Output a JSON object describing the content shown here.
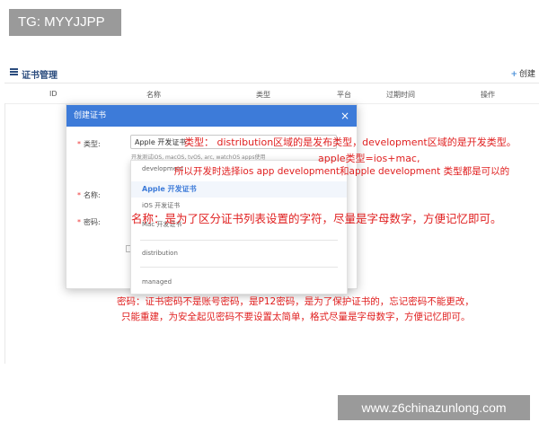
{
  "watermark": {
    "tag": "TG: MYYJJPP",
    "site": "www.z6chinazunlong.com"
  },
  "header": {
    "title": "证书管理",
    "create_label": "创建",
    "create_icon": "plus-icon"
  },
  "table": {
    "columns": [
      "ID",
      "名称",
      "类型",
      "平台",
      "过期时间",
      "操作"
    ]
  },
  "modal": {
    "title": "创建证书",
    "close_glyph": "×",
    "fields": {
      "type_label": "类型:",
      "type_value": "Apple 开发证书",
      "type_hint": "开发测试iOS, macOS, tvOS, arc, watchOS apps使用",
      "name_label": "名称:",
      "password_label": "密码:"
    },
    "dropdown": {
      "options": [
        "development",
        "Apple 开发证书",
        "iOS 开发证书",
        "Mac 开发证书",
        "distribution",
        "managed"
      ],
      "selected": "Apple 开发证书"
    }
  },
  "annotations": {
    "type_note": "类型：  distribution区域的是发布类型，development区域的是开发类型。",
    "apple_note": "apple类型=ios+mac,",
    "dev_note": "所以开发时选择ios app development和apple development 类型都是可以的",
    "name_note": "名称：是为了区分证书列表设置的字符，尽量是字母数字，方便记忆即可。",
    "password_note_1": "密码：证书密码不是账号密码，是P12密码，是为了保护证书的，忘记密码不能更改，",
    "password_note_2": "只能重建，为安全起见密码不要设置太简单，格式尽量是字母数字，方便记忆即可。"
  },
  "colors": {
    "accent": "#3d7bd9",
    "annotation": "#e02020",
    "title": "#2b4c7e"
  }
}
